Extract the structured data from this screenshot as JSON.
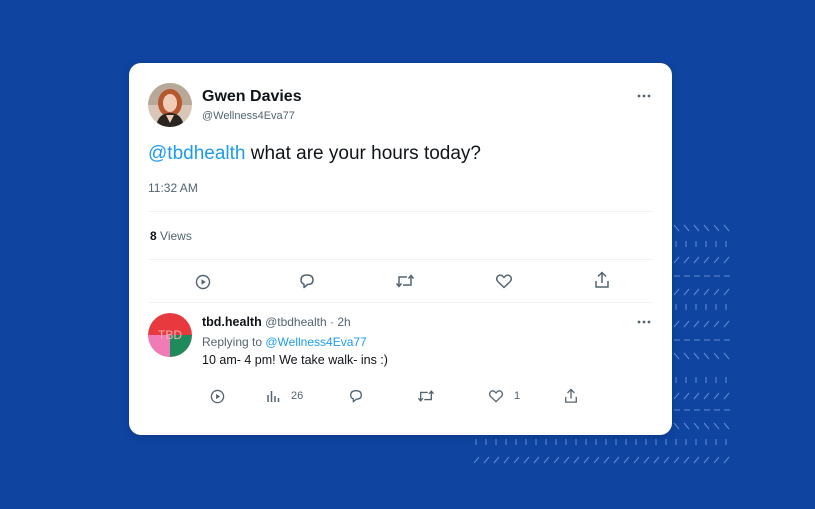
{
  "background": {
    "color": "#0f44a0",
    "pattern": "dashed-stripes"
  },
  "tweet": {
    "author_name": "Gwen Davies",
    "author_handle": "@Wellness4Eva77",
    "mention": "@tbdhealth",
    "text": " what are your hours today?",
    "time": "11:32 AM",
    "view_count": "8",
    "views_label": "Views",
    "actions": [
      "view-icon",
      "reply-icon",
      "retweet-icon",
      "like-icon",
      "share-icon"
    ]
  },
  "reply": {
    "author_name": "tbd.health",
    "author_handle": "@tbdhealth",
    "separator": "·",
    "age": "2h",
    "replying_label": "Replying to ",
    "replying_to": "@Wellness4Eva77",
    "avatar_text": "TBD",
    "text": "10 am- 4 pm! We take walk- ins :)",
    "analytics_count": "26",
    "like_count": "1"
  },
  "colors": {
    "link": "#1d9bf0",
    "text": "#0f1419",
    "muted": "#536471",
    "avatar_red": "#e8393f",
    "avatar_green": "#1f8a5c",
    "avatar_pink": "#f07bb7"
  }
}
